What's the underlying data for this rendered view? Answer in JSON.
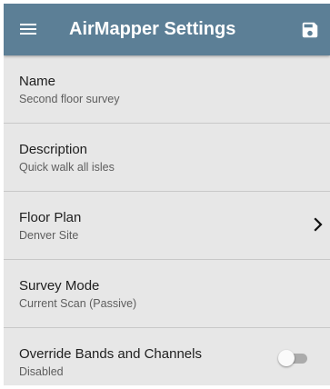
{
  "header": {
    "title": "AirMapper Settings",
    "menu_icon": "hamburger-menu-icon",
    "save_icon": "floppy-disk-save-icon",
    "background_color": "#5c7f96"
  },
  "settings": [
    {
      "label": "Name",
      "value": "Second floor survey"
    },
    {
      "label": "Description",
      "value": "Quick walk all isles"
    },
    {
      "label": "Floor Plan",
      "value": "Denver Site",
      "chevron_icon": "chevron-right-icon"
    },
    {
      "label": "Survey Mode",
      "value": "Current Scan (Passive)"
    },
    {
      "label": "Override Bands and Channels",
      "value": "Disabled",
      "toggle_on": false
    }
  ]
}
